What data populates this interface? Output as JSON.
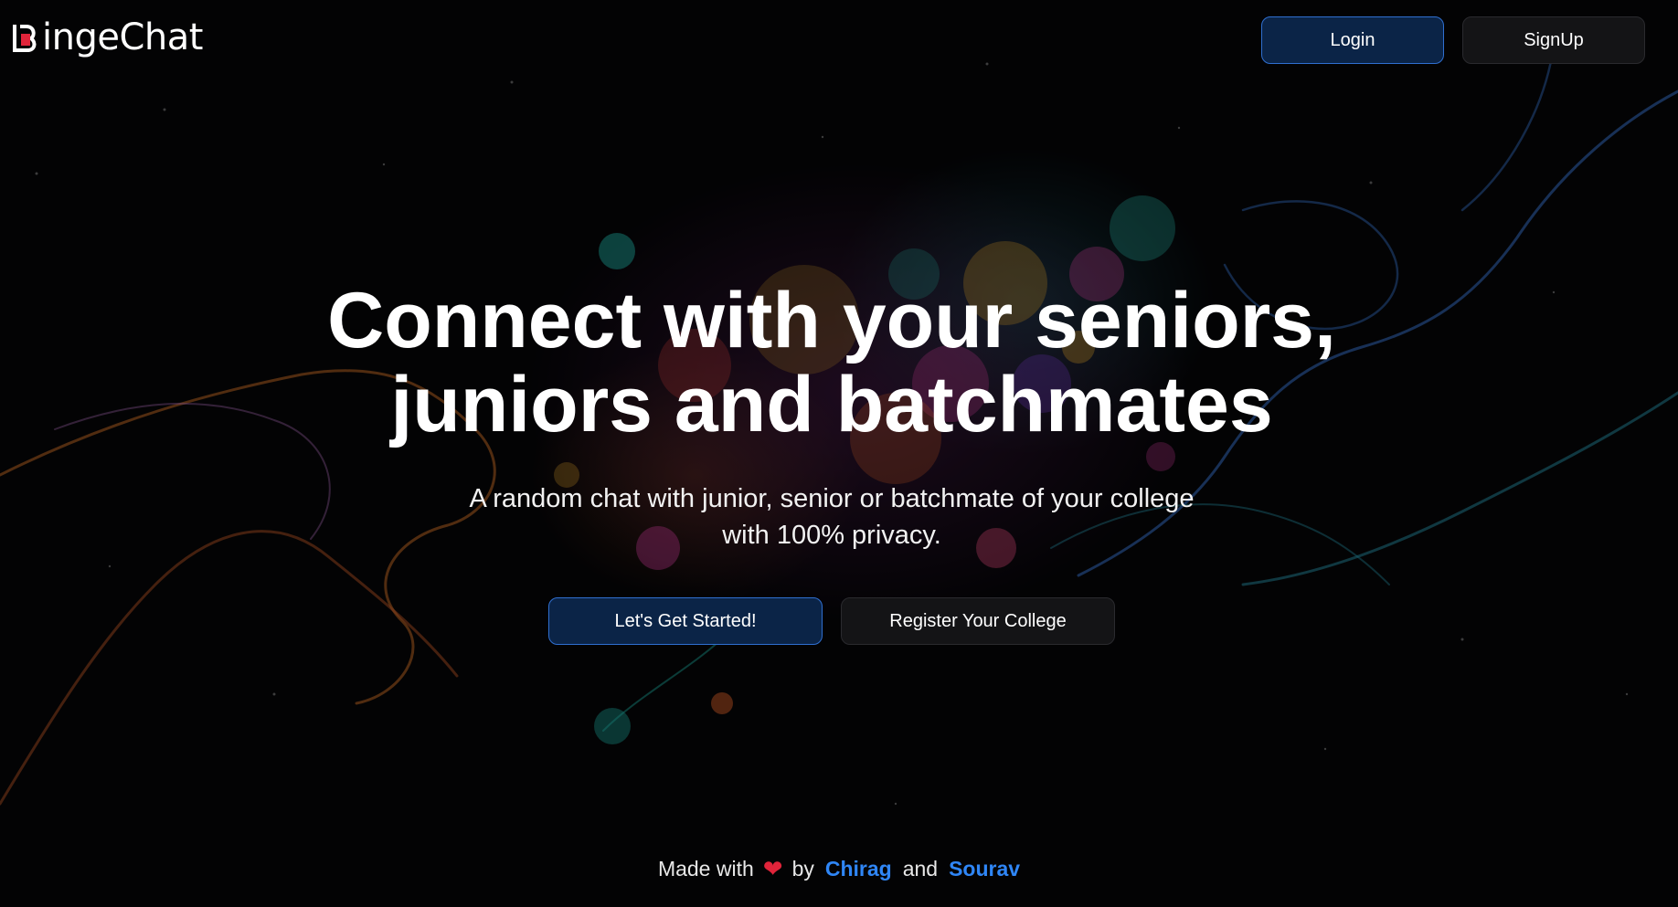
{
  "header": {
    "logo_text": "ingeChat",
    "login_label": "Login",
    "signup_label": "SignUp"
  },
  "hero": {
    "title_line1": "Connect with your seniors,",
    "title_line2": "juniors and batchmates",
    "subtitle_line1": "A random chat with junior, senior or batchmate of your college",
    "subtitle_line2": "with 100% privacy.",
    "primary_cta": "Let's Get Started!",
    "secondary_cta": "Register Your College"
  },
  "footer": {
    "made_with": "Made with",
    "by": "by",
    "author1": "Chirag",
    "and": "and",
    "author2": "Sourav"
  },
  "colors": {
    "accent_blue": "#2f86f6",
    "primary_button_bg": "#0b2447",
    "logo_red": "#e0243a"
  },
  "icons": {
    "logo_mark": "binge-logo-icon",
    "heart": "heart-icon"
  }
}
